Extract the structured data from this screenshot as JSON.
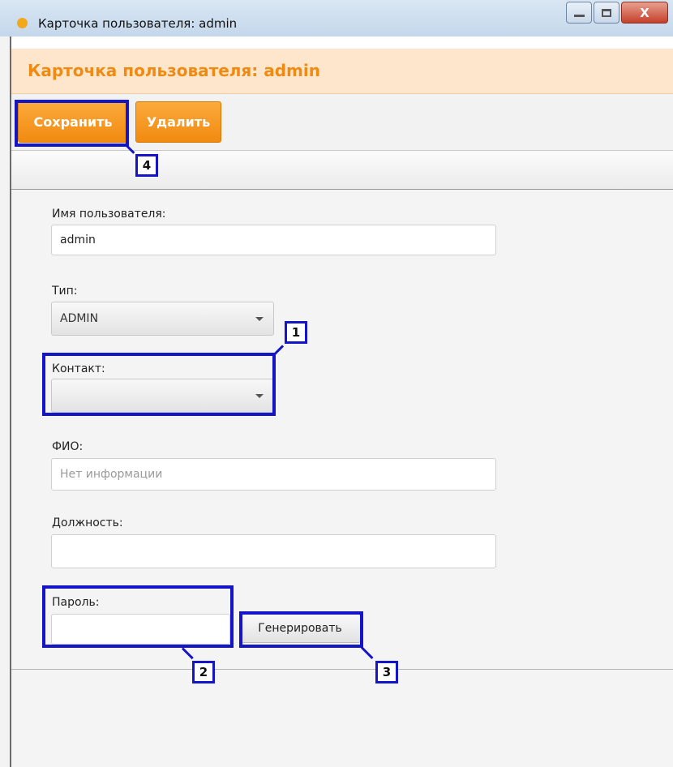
{
  "window": {
    "title": "Карточка пользователя: admin",
    "close_glyph": "X"
  },
  "header": {
    "title": "Карточка пользователя: admin"
  },
  "toolbar": {
    "save_label": "Сохранить",
    "delete_label": "Удалить"
  },
  "form": {
    "username": {
      "label": "Имя пользователя:",
      "value": "admin"
    },
    "type": {
      "label": "Тип:",
      "selected": "ADMIN"
    },
    "contact": {
      "label": "Контакт:",
      "selected": ""
    },
    "fio": {
      "label": "ФИО:",
      "placeholder": "Нет информации"
    },
    "position": {
      "label": "Должность:",
      "value": ""
    },
    "password": {
      "label": "Пароль:",
      "value": "",
      "generate_label": "Генерировать"
    }
  },
  "annotations": [
    "1",
    "2",
    "3",
    "4"
  ],
  "colors": {
    "accent_orange": "#f18a10",
    "header_bg": "#fde6cc",
    "annotation_blue": "#1414c8"
  }
}
